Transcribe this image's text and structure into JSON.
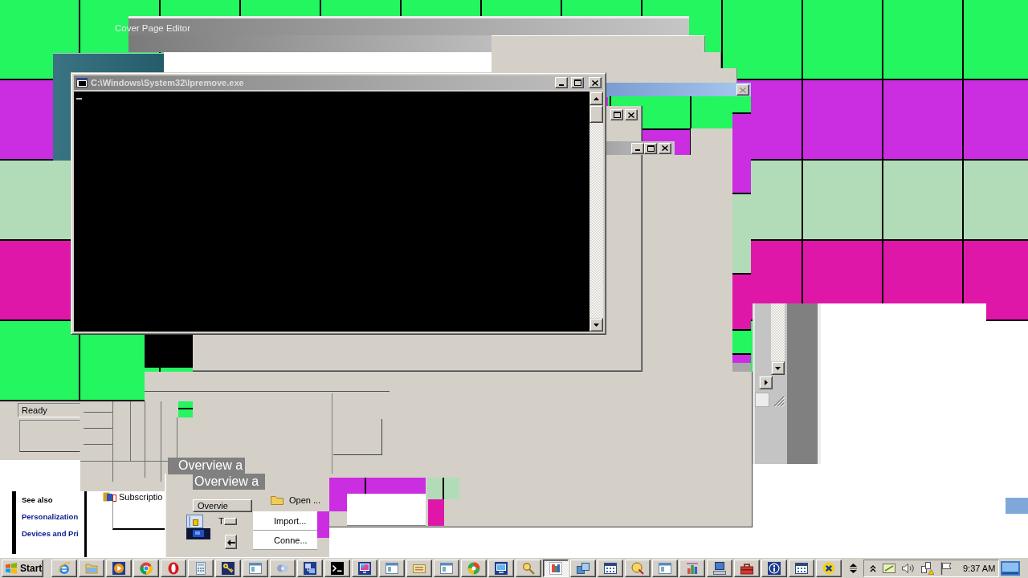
{
  "cover_page_editor": {
    "title": "Cover Page Editor"
  },
  "dialog_title_bar": {
    "close": {
      "disabled": true
    }
  },
  "console": {
    "title": "C:\\Windows\\System32\\lpremove.exe"
  },
  "status_window": {
    "status": "Ready"
  },
  "help_panel": {
    "heading": "See also",
    "links": [
      "Personalization",
      "Devices and Pri"
    ]
  },
  "tree": {
    "items": [
      {
        "label": "Subscriptio"
      }
    ]
  },
  "section_headers": [
    "Overview a",
    "Overview a"
  ],
  "snap_in": {
    "button": "Overvie",
    "label": "T",
    "actions": [
      {
        "kind": "folder",
        "label": "Open ..."
      },
      {
        "kind": "plain",
        "label": "Import..."
      },
      {
        "kind": "plain",
        "label": "Conne..."
      }
    ]
  },
  "taskbar": {
    "start": "Start",
    "buttons": [
      {
        "selected": false
      },
      {
        "selected": false
      },
      {
        "selected": false
      },
      {
        "selected": false
      },
      {
        "selected": false
      },
      {
        "selected": false
      },
      {
        "selected": false
      },
      {
        "selected": false
      },
      {
        "selected": false
      },
      {
        "selected": false
      },
      {
        "selected": false
      },
      {
        "selected": false
      },
      {
        "selected": false
      },
      {
        "selected": false
      },
      {
        "selected": false
      },
      {
        "selected": false
      },
      {
        "selected": false
      },
      {
        "selected": false
      },
      {
        "selected": true
      },
      {
        "selected": false
      },
      {
        "selected": false
      },
      {
        "selected": false
      },
      {
        "selected": false
      },
      {
        "selected": false
      },
      {
        "selected": false
      },
      {
        "selected": false
      },
      {
        "selected": false
      },
      {
        "selected": false
      },
      {
        "selected": false
      }
    ],
    "clock": "9:37 AM"
  }
}
